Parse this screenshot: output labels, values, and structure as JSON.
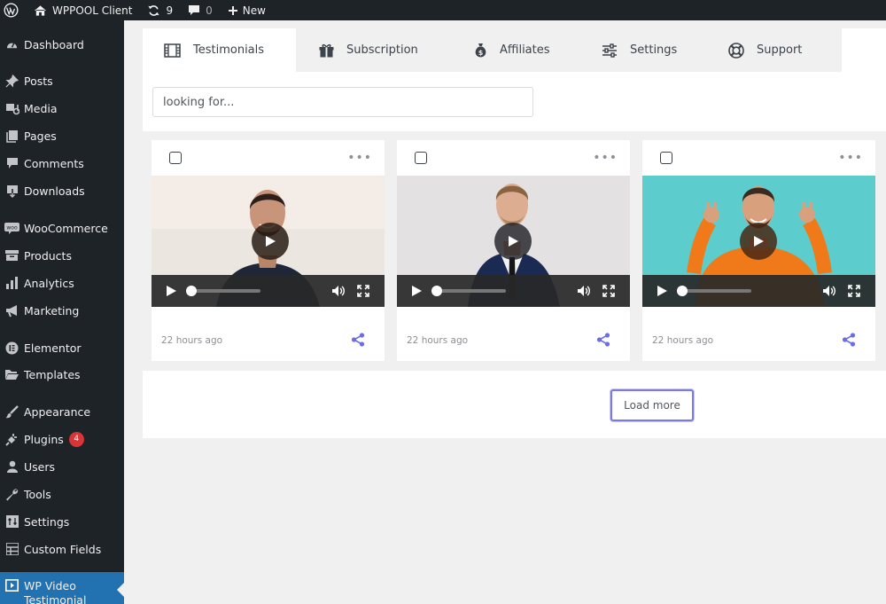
{
  "adminbar": {
    "site_name": "WPPOOL Client",
    "updates_count": "9",
    "comments_count": "0",
    "new_label": "New"
  },
  "sidebar": {
    "items": [
      {
        "label": "Dashboard",
        "icon": "dashboard-icon"
      },
      {
        "label": "Posts",
        "icon": "pin-icon"
      },
      {
        "label": "Media",
        "icon": "media-icon"
      },
      {
        "label": "Pages",
        "icon": "pages-icon"
      },
      {
        "label": "Comments",
        "icon": "comment-icon"
      },
      {
        "label": "Downloads",
        "icon": "download-icon"
      },
      {
        "label": "WooCommerce",
        "icon": "woo-icon"
      },
      {
        "label": "Products",
        "icon": "archive-icon"
      },
      {
        "label": "Analytics",
        "icon": "bar-chart-icon"
      },
      {
        "label": "Marketing",
        "icon": "megaphone-icon"
      },
      {
        "label": "Elementor",
        "icon": "elementor-icon"
      },
      {
        "label": "Templates",
        "icon": "folder-icon"
      },
      {
        "label": "Appearance",
        "icon": "brush-icon"
      },
      {
        "label": "Plugins",
        "icon": "plugin-icon",
        "badge": "4"
      },
      {
        "label": "Users",
        "icon": "user-icon"
      },
      {
        "label": "Tools",
        "icon": "wrench-icon"
      },
      {
        "label": "Settings",
        "icon": "settings-icon"
      },
      {
        "label": "Custom Fields",
        "icon": "grid-icon"
      },
      {
        "label": "WP Video Testimonial",
        "icon": "video-icon",
        "active": true
      }
    ]
  },
  "tabs": [
    {
      "label": "Testimonials",
      "icon": "film-icon",
      "active": true
    },
    {
      "label": "Subscription",
      "icon": "gift-icon"
    },
    {
      "label": "Affiliates",
      "icon": "money-bag-icon"
    },
    {
      "label": "Settings",
      "icon": "sliders-icon"
    },
    {
      "label": "Support",
      "icon": "lifebuoy-icon"
    }
  ],
  "search": {
    "placeholder": "looking for..."
  },
  "cards": [
    {
      "time": "22 hours ago",
      "scene": "man-dark-tshirt-light-background"
    },
    {
      "time": "22 hours ago",
      "scene": "man-navy-suit-grey-background"
    },
    {
      "time": "22 hours ago",
      "scene": "man-orange-sweater-teal-background"
    }
  ],
  "load_more_label": "Load more",
  "colors": {
    "admin_dark": "#1d2327",
    "active_menu": "#2271b1",
    "accent": "#7b79e3",
    "badge": "#d63638"
  }
}
